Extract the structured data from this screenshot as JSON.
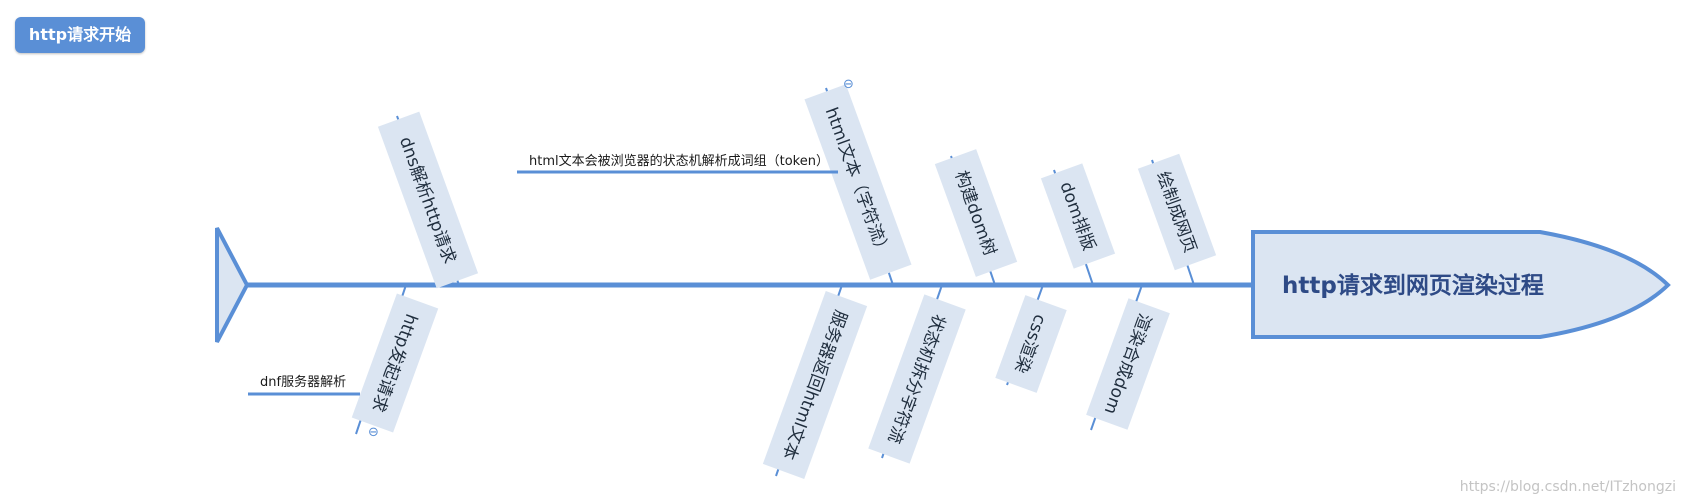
{
  "start_button": {
    "label": "http请求开始"
  },
  "head": {
    "label": "http请求到网页渲染过程"
  },
  "top_branches": [
    {
      "label": "dns解析http请求"
    },
    {
      "label": "html文本（字符流）"
    },
    {
      "label": "构建dom树"
    },
    {
      "label": "dom排版"
    },
    {
      "label": "绘制成网页"
    }
  ],
  "bottom_branches": [
    {
      "label": "http发起请求"
    },
    {
      "label": "服务器返回html文本"
    },
    {
      "label": "状态机拆分字符流"
    },
    {
      "label": "css渲染"
    },
    {
      "label": "渲染合成dom"
    }
  ],
  "sub_branches": {
    "html_text_note": "html文本会被浏览器的状态机解析成词组（token）",
    "dns_note": "dnf服务器解析"
  },
  "collapse_icons": [
    "⊖",
    "⊖"
  ],
  "colors": {
    "spine": "#5a8fd6",
    "label_bg": "#dbe5f2",
    "head_fill": "#dbe5f2",
    "start_button_bg": "#5a8fd6"
  },
  "watermark": "https://blog.csdn.net/ITzhongzi"
}
